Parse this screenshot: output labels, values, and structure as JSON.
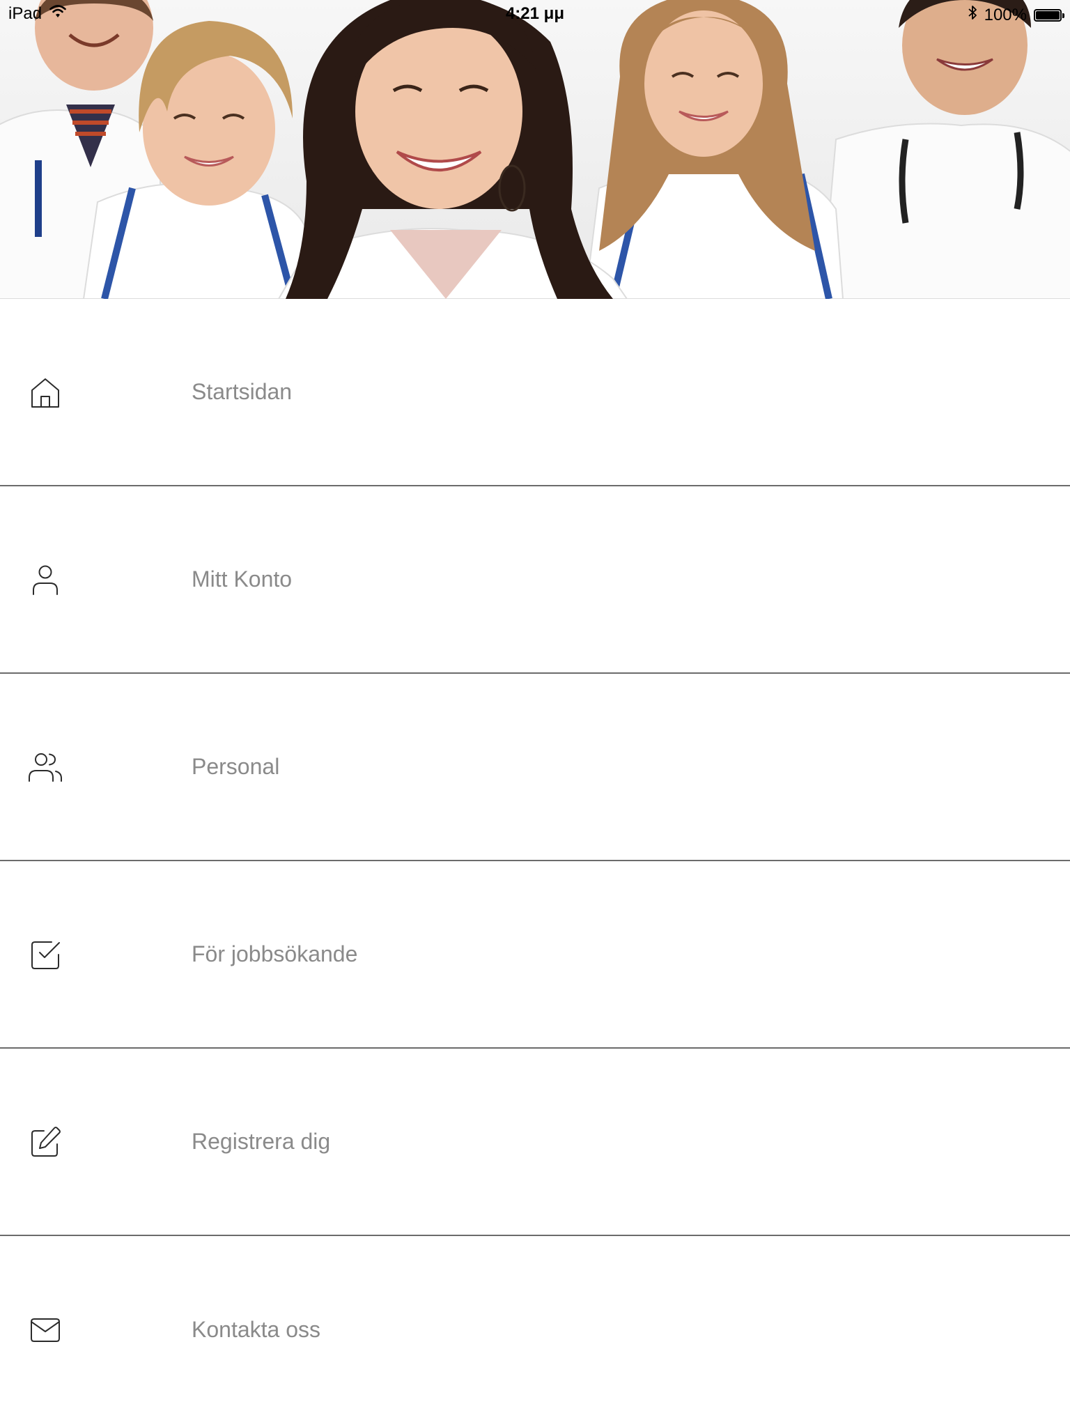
{
  "status_bar": {
    "device": "iPad",
    "time": "4:21 μμ",
    "battery_text": "100%",
    "battery_level": 1.0,
    "icons": [
      "wifi-icon",
      "bluetooth-icon",
      "battery-icon"
    ]
  },
  "hero": {
    "image_alt": "Group of smiling medical staff in white coats",
    "icon": "hero-photo"
  },
  "menu": {
    "items": [
      {
        "label": "Startsidan",
        "icon": "home-icon"
      },
      {
        "label": "Mitt Konto",
        "icon": "user-icon"
      },
      {
        "label": "Personal",
        "icon": "users-icon"
      },
      {
        "label": "För jobbsökande",
        "icon": "check-square-icon"
      },
      {
        "label": "Registrera dig",
        "icon": "edit-icon"
      },
      {
        "label": "Kontakta oss",
        "icon": "mail-icon"
      }
    ]
  },
  "colors": {
    "label": "#8a8a8a",
    "icon": "#2b2b2b",
    "divider": "#6b6b6b",
    "background": "#ffffff"
  }
}
